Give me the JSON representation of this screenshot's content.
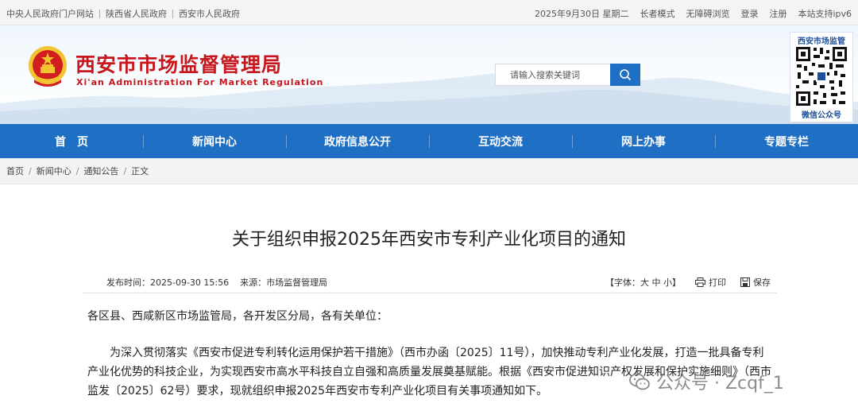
{
  "topbar": {
    "links": [
      "中央人民政府门户网站",
      "陕西省人民政府",
      "西安市人民政府"
    ],
    "date": "2025年9月30日 星期二",
    "elder_mode": "长者模式",
    "accessible": "无障碍浏览",
    "login": "登录",
    "register": "注册",
    "ipv6": "本站支持ipv6"
  },
  "header": {
    "title": "西安市市场监督管理局",
    "subtitle": "Xi'an Administration For Market Regulation",
    "search_placeholder": "请输入搜索关键词",
    "qr_title": "西安市场监管",
    "qr_footer": "微信公众号"
  },
  "nav": [
    "首　页",
    "新闻中心",
    "政府信息公开",
    "互动交流",
    "网上办事",
    "专题专栏"
  ],
  "breadcrumb": [
    "首页",
    "新闻中心",
    "通知公告",
    "正文"
  ],
  "article": {
    "title": "关于组织申报2025年西安市专利产业化项目的通知",
    "publish_time": "发布时间：2025-09-30 15:56",
    "source": "来源：市场监督管理局",
    "font_size": "【字体：大 中 小】",
    "print": "打印",
    "save": "保存",
    "salutation": "各区县、西咸新区市场监管局，各开发区分局，各有关单位：",
    "paragraph1": "为深入贯彻落实《西安市促进专利转化运用保护若干措施》（西市办函〔2025〕11号），加快推动专利产业化发展，打造一批具备专利产业化优势的科技企业，为实现西安市高水平科技自立自强和高质量发展奠基赋能。根据《西安市促进知识产权发展和保护实施细则》（西市监发〔2025〕62号）要求，现就组织申报2025年西安市专利产业化项目有关事项通知如下。"
  },
  "watermark": "公众号 · Zcqf_1",
  "colors": {
    "brand_red": "#c8161d",
    "nav_blue": "#1f6fc4"
  }
}
